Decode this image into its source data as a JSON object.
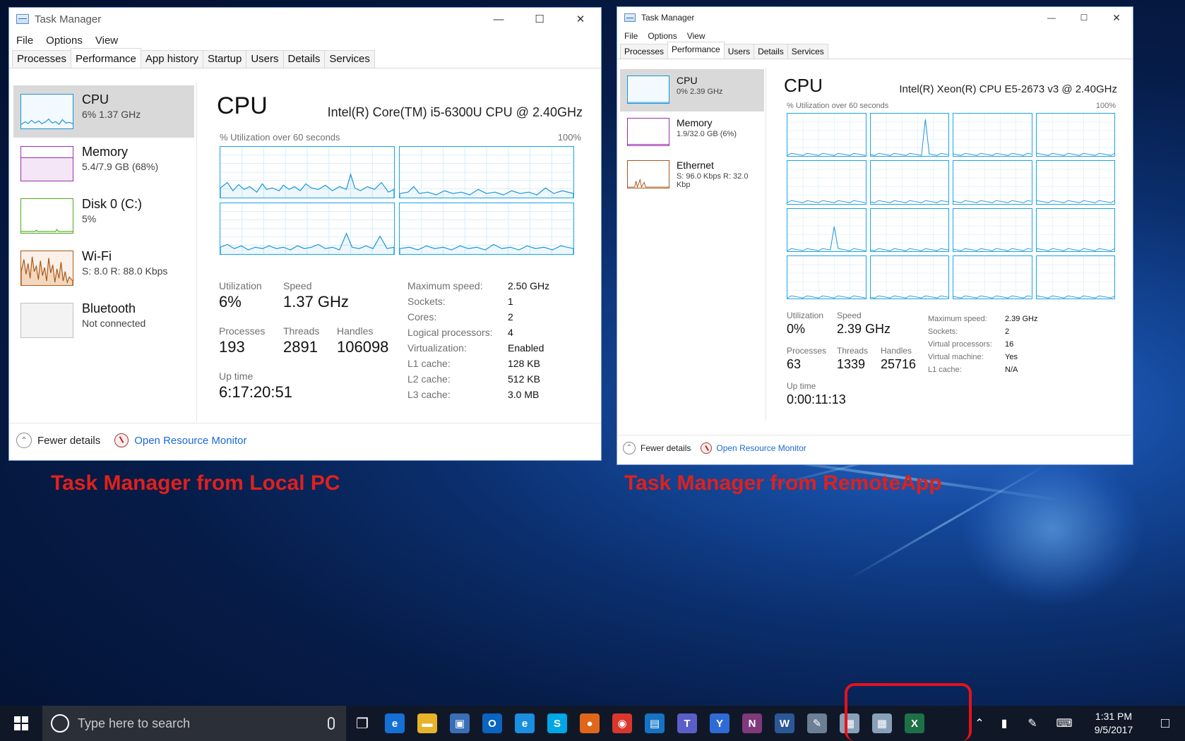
{
  "local": {
    "title": "Task Manager",
    "menu": [
      "File",
      "Options",
      "View"
    ],
    "tabs": [
      "Processes",
      "Performance",
      "App history",
      "Startup",
      "Users",
      "Details",
      "Services"
    ],
    "active_tab": "Performance",
    "sidebar": [
      {
        "name": "CPU",
        "sub": "6% 1.37 GHz",
        "color": "#1a94d8",
        "selected": true
      },
      {
        "name": "Memory",
        "sub": "5.4/7.9 GB (68%)",
        "color": "#9b2fae",
        "selected": false
      },
      {
        "name": "Disk 0 (C:)",
        "sub": "5%",
        "color": "#4daa1d",
        "selected": false
      },
      {
        "name": "Wi-Fi",
        "sub": "S: 8.0 R: 88.0 Kbps",
        "color": "#a8581a",
        "selected": false
      },
      {
        "name": "Bluetooth",
        "sub": "Not connected",
        "color": "#c0c0c0",
        "selected": false
      }
    ],
    "main": {
      "heading": "CPU",
      "model": "Intel(R) Core(TM) i5-6300U CPU @ 2.40GHz",
      "util_label": "% Utilization over 60 seconds",
      "max_label": "100%",
      "stats": {
        "utilization_label": "Utilization",
        "utilization": "6%",
        "speed_label": "Speed",
        "speed": "1.37 GHz",
        "processes_label": "Processes",
        "processes": "193",
        "threads_label": "Threads",
        "threads": "2891",
        "handles_label": "Handles",
        "handles": "106098",
        "uptime_label": "Up time",
        "uptime": "6:17:20:51"
      },
      "details": [
        {
          "k": "Maximum speed:",
          "v": "2.50 GHz"
        },
        {
          "k": "Sockets:",
          "v": "1"
        },
        {
          "k": "Cores:",
          "v": "2"
        },
        {
          "k": "Logical processors:",
          "v": "4"
        },
        {
          "k": "Virtualization:",
          "v": "Enabled"
        },
        {
          "k": "L1 cache:",
          "v": "128 KB"
        },
        {
          "k": "L2 cache:",
          "v": "512 KB"
        },
        {
          "k": "L3 cache:",
          "v": "3.0 MB"
        }
      ]
    },
    "footer": {
      "fewer": "Fewer details",
      "resmon": "Open Resource Monitor"
    }
  },
  "remote": {
    "title": "Task Manager",
    "menu": [
      "File",
      "Options",
      "View"
    ],
    "tabs": [
      "Processes",
      "Performance",
      "Users",
      "Details",
      "Services"
    ],
    "active_tab": "Performance",
    "sidebar": [
      {
        "name": "CPU",
        "sub": "0% 2.39 GHz",
        "color": "#1a94d8",
        "selected": true
      },
      {
        "name": "Memory",
        "sub": "1.9/32.0 GB (6%)",
        "color": "#9b2fae",
        "selected": false
      },
      {
        "name": "Ethernet",
        "sub": "S: 96.0 Kbps R: 32.0 Kbp",
        "color": "#a8581a",
        "selected": false
      }
    ],
    "main": {
      "heading": "CPU",
      "model": "Intel(R) Xeon(R) CPU E5-2673 v3 @ 2.40GHz",
      "util_label": "% Utilization over 60 seconds",
      "max_label": "100%",
      "stats": {
        "utilization_label": "Utilization",
        "utilization": "0%",
        "speed_label": "Speed",
        "speed": "2.39 GHz",
        "processes_label": "Processes",
        "processes": "63",
        "threads_label": "Threads",
        "threads": "1339",
        "handles_label": "Handles",
        "handles": "25716",
        "uptime_label": "Up time",
        "uptime": "0:00:11:13"
      },
      "details": [
        {
          "k": "Maximum speed:",
          "v": "2.39 GHz"
        },
        {
          "k": "Sockets:",
          "v": "2"
        },
        {
          "k": "Virtual processors:",
          "v": "16"
        },
        {
          "k": "Virtual machine:",
          "v": "Yes"
        },
        {
          "k": "L1 cache:",
          "v": "N/A"
        }
      ]
    },
    "footer": {
      "fewer": "Fewer details",
      "resmon": "Open Resource Monitor"
    }
  },
  "captions": {
    "local": "Task Manager from Local PC",
    "remote": "Task Manager from RemoteApp"
  },
  "taskbar": {
    "search_placeholder": "Type here to search",
    "time": "1:31 PM",
    "date": "9/5/2017",
    "apps": [
      {
        "name": "task-view-icon",
        "color": "#101828",
        "glyph": "❐"
      },
      {
        "name": "edge-icon",
        "color": "#1570d6",
        "glyph": "e"
      },
      {
        "name": "file-explorer-icon",
        "color": "#e7b32a",
        "glyph": "▬"
      },
      {
        "name": "remote-desktop-icon",
        "color": "#3a6fb8",
        "glyph": "▣"
      },
      {
        "name": "outlook-icon",
        "color": "#0a64c1",
        "glyph": "O"
      },
      {
        "name": "internet-explorer-icon",
        "color": "#1a8ee0",
        "glyph": "e"
      },
      {
        "name": "skype-icon",
        "color": "#00a7e6",
        "glyph": "S"
      },
      {
        "name": "firefox-icon",
        "color": "#e0661b",
        "glyph": "●"
      },
      {
        "name": "chrome-icon",
        "color": "#d9372e",
        "glyph": "◉"
      },
      {
        "name": "network-icon",
        "color": "#1573c5",
        "glyph": "▤"
      },
      {
        "name": "teams-icon",
        "color": "#5a5fc8",
        "glyph": "T"
      },
      {
        "name": "yammer-icon",
        "color": "#2f6bd5",
        "glyph": "Y"
      },
      {
        "name": "onenote-icon",
        "color": "#80397b",
        "glyph": "N"
      },
      {
        "name": "word-icon",
        "color": "#2b5797",
        "glyph": "W"
      },
      {
        "name": "paint-icon",
        "color": "#6c7f94",
        "glyph": "✎"
      },
      {
        "name": "taskmanager-remote-icon",
        "color": "#8aa0b8",
        "glyph": "▦"
      },
      {
        "name": "taskmanager-local-icon",
        "color": "#8aa0b8",
        "glyph": "▦"
      },
      {
        "name": "excel-remote-icon",
        "color": "#1e7145",
        "glyph": "X"
      }
    ]
  }
}
